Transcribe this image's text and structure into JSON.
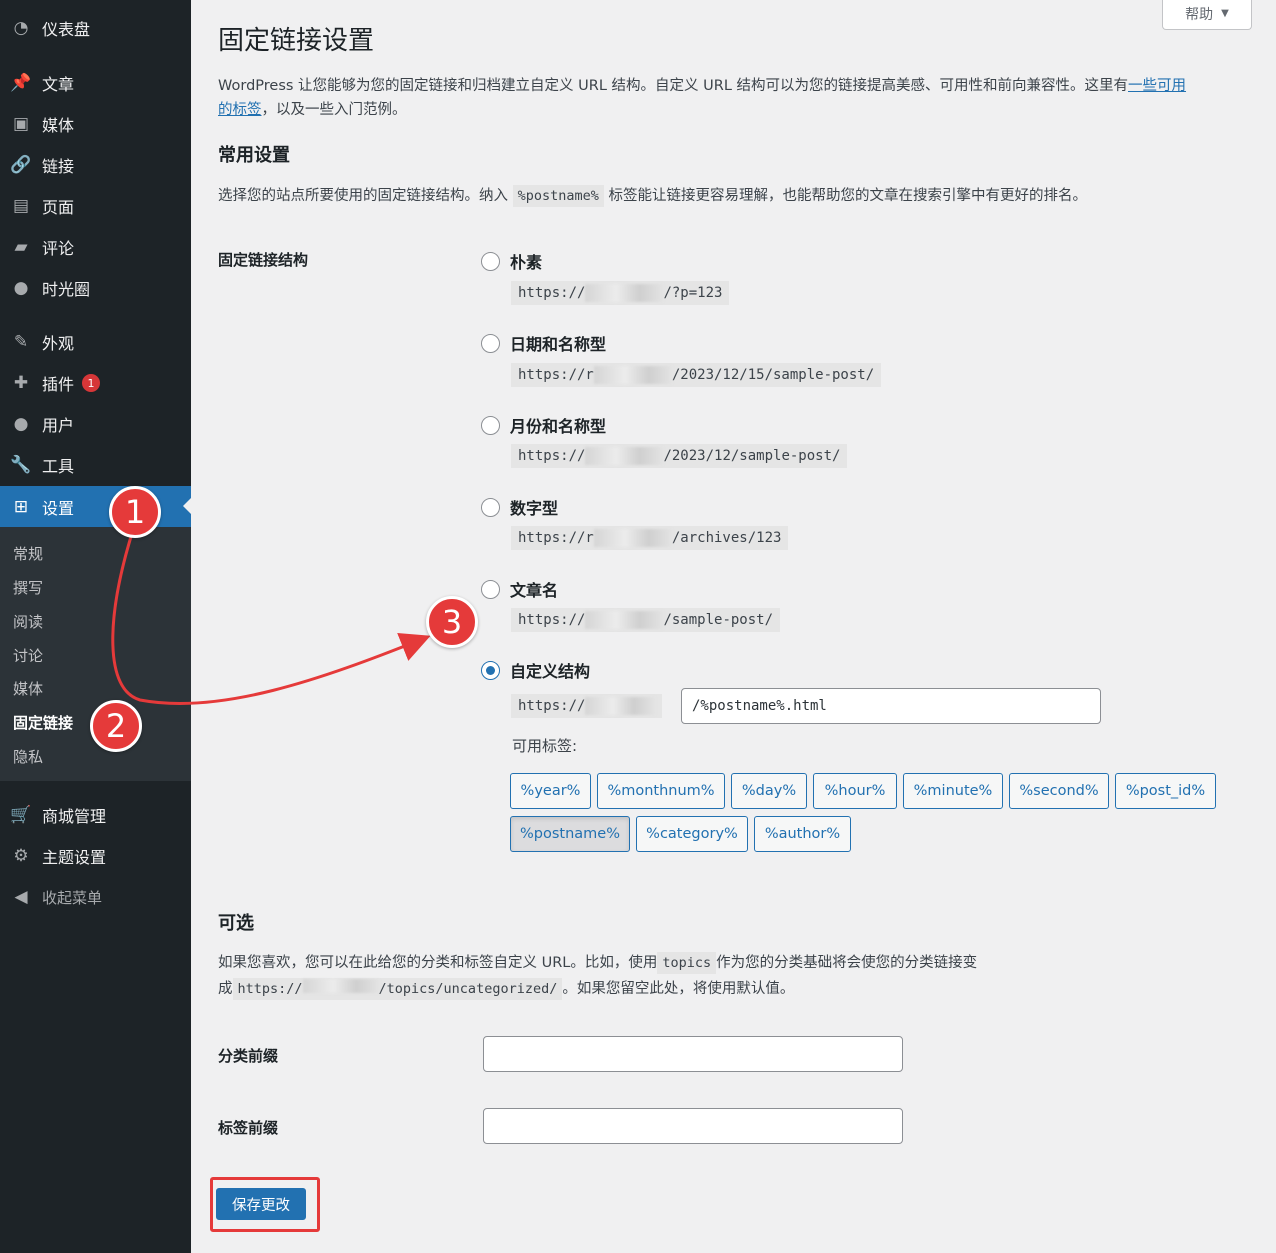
{
  "help": {
    "label": "帮助",
    "caret": "▼"
  },
  "sidebar": {
    "items": [
      {
        "label": "仪表盘",
        "icon": "◔"
      },
      {
        "label": "文章",
        "icon": "📌"
      },
      {
        "label": "媒体",
        "icon": "▣"
      },
      {
        "label": "链接",
        "icon": "🔗"
      },
      {
        "label": "页面",
        "icon": "▤"
      },
      {
        "label": "评论",
        "icon": "▰"
      },
      {
        "label": "时光圈",
        "icon": "●"
      },
      {
        "label": "外观",
        "icon": "✎"
      },
      {
        "label": "插件",
        "icon": "✚",
        "badge": "1"
      },
      {
        "label": "用户",
        "icon": "●"
      },
      {
        "label": "工具",
        "icon": "🔧"
      },
      {
        "label": "设置",
        "icon": "⊞"
      }
    ],
    "submenu": [
      "常规",
      "撰写",
      "阅读",
      "讨论",
      "媒体",
      "固定链接",
      "隐私"
    ],
    "extra": [
      {
        "label": "商城管理",
        "icon": "🛒"
      },
      {
        "label": "主题设置",
        "icon": "⚙"
      },
      {
        "label": "收起菜单",
        "icon": "◀"
      }
    ]
  },
  "page": {
    "title": "固定链接设置",
    "intro_text": "WordPress 让您能够为您的固定链接和归档建立自定义 URL 结构。自定义 URL 结构可以为您的链接提高美感、可用性和前向兼容性。这里有",
    "intro_link_line1": "一些可用",
    "intro_link_line2": "的标签",
    "intro_tail": "，以及一些入门范例。"
  },
  "common": {
    "title": "常用设置",
    "desc_pre": "选择您的站点所要使用的固定链接结构。纳入",
    "desc_code": "%postname%",
    "desc_post": "标签能让链接更容易理解，也能帮助您的文章在搜索引擎中有更好的排名。",
    "row_label": "固定链接结构",
    "options": [
      {
        "label": "朴素",
        "prefix": "https://",
        "suffix": "/?p=123"
      },
      {
        "label": "日期和名称型",
        "prefix": "https://r",
        "suffix": "/2023/12/15/sample-post/"
      },
      {
        "label": "月份和名称型",
        "prefix": "https://",
        "suffix": "/2023/12/sample-post/"
      },
      {
        "label": "数字型",
        "prefix": "https://r",
        "suffix": "/archives/123"
      },
      {
        "label": "文章名",
        "prefix": "https://",
        "suffix": "/sample-post/"
      },
      {
        "label": "自定义结构",
        "prefix": "https://",
        "suffix": ""
      }
    ],
    "custom_value": "/%postname%.html",
    "available_tags_label": "可用标签:",
    "tags": [
      "%year%",
      "%monthnum%",
      "%day%",
      "%hour%",
      "%minute%",
      "%second%",
      "%post_id%",
      "%postname%",
      "%category%",
      "%author%"
    ]
  },
  "optional": {
    "title": "可选",
    "desc_a": "如果您喜欢，您可以在此给您的分类和标签自定义 URL。比如，使用",
    "desc_code1": "topics",
    "desc_b": "作为您的分类基础将会使您的分类链接变",
    "desc_c": "成",
    "desc_code2_pre": "https://",
    "desc_code2_post": "/topics/uncategorized/",
    "desc_d": "。如果您留空此处，将使用默认值。",
    "category_label": "分类前缀",
    "tag_label": "标签前缀"
  },
  "save": {
    "label": "保存更改"
  },
  "annotations": {
    "m1": "1",
    "m2": "2",
    "m3": "3",
    "color": "#e53a3a"
  }
}
